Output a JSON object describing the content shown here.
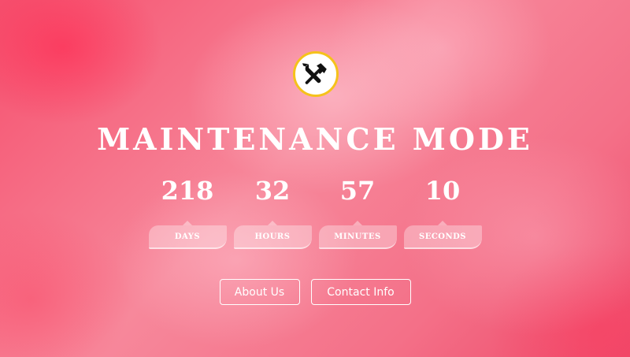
{
  "logo": {
    "icon": "tools-icon",
    "border_color": "#f5c21b"
  },
  "page": {
    "title": "MAINTENANCE MODE"
  },
  "countdown": [
    {
      "value": "218",
      "label": "DAYS"
    },
    {
      "value": "32",
      "label": "HOURS"
    },
    {
      "value": "57",
      "label": "MINUTES"
    },
    {
      "value": "10",
      "label": "SECONDS"
    }
  ],
  "buttons": {
    "about_label": "About Us",
    "contact_label": "Contact Info"
  },
  "colors": {
    "background_accent": "#f5506e",
    "text": "#ffffff"
  }
}
